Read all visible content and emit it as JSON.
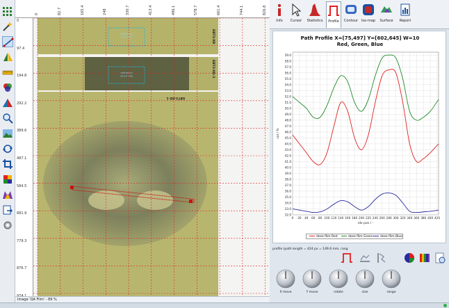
{
  "colors": {
    "accent": "#c62828",
    "grid": "#d8d8d8",
    "red_series": "#e02020",
    "green_series": "#1f8a2a",
    "blue_series": "#2a2aa0",
    "roi_line": "#cc1111",
    "film_green": "#b8b66a",
    "film_dark": "#5f6244",
    "ref_box": "#22b5d6"
  },
  "toolbar": {
    "tools": [
      {
        "name": "grid-icon"
      },
      {
        "name": "magic-wand-icon"
      },
      {
        "name": "line-profile-icon"
      },
      {
        "name": "flip-icon"
      },
      {
        "name": "ruler-icon"
      },
      {
        "name": "color-channels-icon"
      },
      {
        "name": "triangle-icon"
      },
      {
        "name": "zoom-icon"
      },
      {
        "name": "landscape-icon"
      },
      {
        "name": "rotate-icon"
      },
      {
        "name": "crop-icon"
      },
      {
        "name": "puzzle-icon"
      },
      {
        "name": "colormap-icon"
      },
      {
        "name": "export-icon"
      },
      {
        "name": "settings-icon"
      }
    ]
  },
  "viewer": {
    "h_ticks": [
      "0",
      "82.7",
      "165.4",
      "248",
      "330.7",
      "413.4",
      "496.1",
      "578.7",
      "661.4",
      "744.1",
      "826.8"
    ],
    "v_ticks": [
      "0",
      "97.4",
      "194.8",
      "292.2",
      "389.6",
      "487.1",
      "584.5",
      "681.9",
      "779.3",
      "876.7",
      "974.1"
    ],
    "film_labels": {
      "strip1": "reference\n0.0 cGy",
      "strip2": "reference\n313.0 cGy",
      "side1": "EBT3-XD",
      "side2": "EBT3-XD-1",
      "side3": "EBT3-XD-1"
    },
    "status": "Image 'QA Film' - 89 %"
  },
  "tabs": [
    {
      "label": "Info",
      "icon": "info-icon"
    },
    {
      "label": "Cursor",
      "icon": "cursor-icon"
    },
    {
      "label": "Statistics",
      "icon": "statistics-icon"
    },
    {
      "label": "Profile",
      "icon": "profile-icon",
      "active": true
    },
    {
      "label": "Contour",
      "icon": "contour-icon"
    },
    {
      "label": "Iso-map",
      "icon": "isomap-icon"
    },
    {
      "label": "Surface",
      "icon": "surface-icon"
    },
    {
      "label": "Report",
      "icon": "report-icon"
    }
  ],
  "chart_data": {
    "type": "line",
    "title": "Path Profile X=[75,497] Y=[602,645] W=10",
    "subtitle": "Red, Green, Blue",
    "xlabel": "idx pos / -",
    "ylabel": "col / %",
    "xlim": [
      0,
      424
    ],
    "ylim": [
      32,
      59.5
    ],
    "x_ticks": [
      0,
      20,
      40,
      60,
      80,
      100,
      120,
      140,
      160,
      180,
      200,
      220,
      240,
      260,
      280,
      300,
      320,
      340,
      360,
      380,
      400,
      420
    ],
    "y_ticks": [
      32.0,
      33.0,
      34.0,
      35.0,
      36.0,
      37.0,
      38.0,
      39.0,
      40.0,
      41.0,
      42.0,
      43.0,
      44.0,
      45.0,
      46.0,
      47.0,
      48.0,
      49.0,
      50.0,
      51.0,
      52.0,
      53.0,
      54.0,
      55.0,
      56.0,
      57.0,
      58.0,
      59.0
    ],
    "grid": true,
    "legend_position": "bottom",
    "series": [
      {
        "name": "dose film Red",
        "color": "#e02020",
        "x": [
          0,
          20,
          40,
          60,
          80,
          100,
          120,
          140,
          160,
          180,
          200,
          220,
          240,
          260,
          280,
          300,
          320,
          340,
          360,
          380,
          400,
          424
        ],
        "values": [
          45.5,
          44.0,
          42.5,
          41.0,
          40.5,
          42.5,
          47.0,
          51.0,
          49.5,
          45.0,
          43.0,
          45.5,
          51.0,
          55.5,
          56.5,
          56.0,
          51.0,
          44.0,
          41.0,
          41.5,
          42.5,
          44.0
        ]
      },
      {
        "name": "dose film Green",
        "color": "#1f8a2a",
        "x": [
          0,
          20,
          40,
          60,
          80,
          100,
          120,
          140,
          160,
          180,
          200,
          220,
          240,
          260,
          280,
          300,
          320,
          340,
          360,
          380,
          400,
          424
        ],
        "values": [
          52.0,
          51.0,
          50.0,
          48.5,
          48.5,
          50.5,
          53.5,
          55.5,
          54.5,
          51.0,
          49.5,
          51.5,
          55.5,
          58.5,
          59.0,
          58.5,
          55.0,
          49.5,
          48.0,
          48.5,
          49.5,
          51.5
        ]
      },
      {
        "name": "dose film Blue",
        "color": "#2a2aa0",
        "x": [
          0,
          20,
          40,
          60,
          80,
          100,
          120,
          140,
          160,
          180,
          200,
          220,
          240,
          260,
          280,
          300,
          320,
          340,
          360,
          380,
          400,
          424
        ],
        "values": [
          33.0,
          32.8,
          32.6,
          32.4,
          32.5,
          33.0,
          33.8,
          34.4,
          34.2,
          33.4,
          32.8,
          33.4,
          34.6,
          35.5,
          35.7,
          35.3,
          34.0,
          32.6,
          32.4,
          32.5,
          32.6,
          32.8
        ]
      }
    ]
  },
  "controls": {
    "profile_info": "profile (path length = 424 px = 149.6 mm, rang",
    "icons": [
      "profile-shape-icon",
      "horizontal-profile-icon",
      "vertical-profile-icon",
      "rgb-channels-icon",
      "color-bars-icon",
      "export-report-icon"
    ]
  },
  "knobs": [
    {
      "label": "X move"
    },
    {
      "label": "Y move"
    },
    {
      "label": "rotate"
    },
    {
      "label": "size"
    },
    {
      "label": "range"
    }
  ]
}
